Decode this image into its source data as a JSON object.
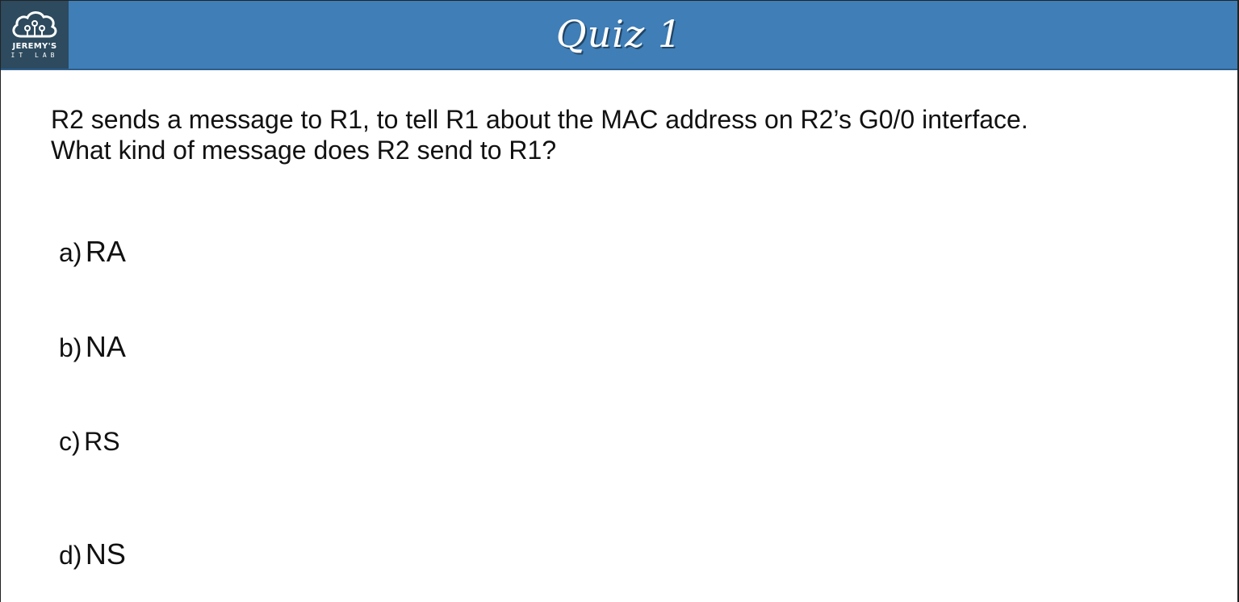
{
  "header": {
    "title": "Quiz 1",
    "logo": {
      "name": "JEREMY'S",
      "sub": "IT LAB",
      "icon": "cloud-circuit-icon"
    }
  },
  "question": {
    "line1": "R2 sends a message to R1, to tell R1 about the MAC address on R2’s G0/0 interface.",
    "line2": "What kind of message does R2 send to R1?"
  },
  "options": [
    {
      "letter": "a)",
      "text": "RA"
    },
    {
      "letter": "b)",
      "text": "NA"
    },
    {
      "letter": "c)",
      "text": "RS"
    },
    {
      "letter": "d)",
      "text": "NS"
    }
  ],
  "colors": {
    "header": "#3f7eb7",
    "logo_bg": "#2d4a5e",
    "text": "#111111"
  }
}
